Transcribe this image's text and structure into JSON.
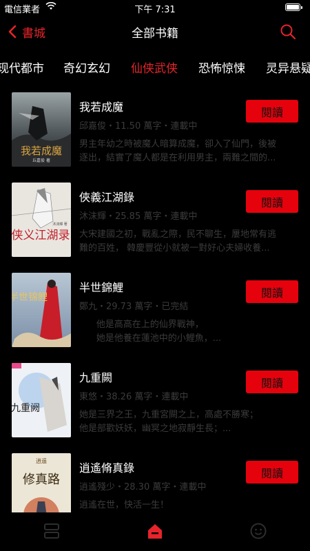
{
  "status": {
    "carrier": "電信業者",
    "time": "下午 7:31",
    "icons": [
      "wifi-icon",
      "battery-icon"
    ]
  },
  "nav": {
    "back_label": "書城",
    "title": "全部书籍",
    "icons": [
      "chevron-left-icon",
      "search-icon"
    ]
  },
  "accent_color": "#e5242b",
  "button_color": "#e5020d",
  "tabs": [
    {
      "label": "现代都市",
      "active": false
    },
    {
      "label": "奇幻玄幻",
      "active": false
    },
    {
      "label": "仙侠武侠",
      "active": true
    },
    {
      "label": "恐怖惊悚",
      "active": false
    },
    {
      "label": "灵异悬疑",
      "active": false
    }
  ],
  "books": [
    {
      "title": "我若成魔",
      "meta": "邱嘉俊・11.50 萬字・連載中",
      "desc": [
        "男主年幼之時被魔人暗算成魔，卻入了仙門，後被",
        "逐出，結實了魔人都是在利用男主，兩難之間的..."
      ],
      "read_label": "閱讀",
      "cover_text": "我若成魔",
      "cover_caption": "丘嘉俊 著"
    },
    {
      "title": "俠義江湖錄",
      "meta": "沐沫輝・25.85 萬字・連載中",
      "desc": [
        "大宋建國之初，戰亂之際，民不聊生，屢地常有逃",
        "難的百姓，   韓慶豐從小就被一對好心夫婦收養..."
      ],
      "read_label": "閱讀",
      "cover_text": "侠义江湖录",
      "cover_caption": "沐沫輝 著"
    },
    {
      "title": "半世錦鯉",
      "meta": "鄭九・29.73 萬字・已完結",
      "desc": [
        "      他是高高在上的仙界戰神，",
        "      她是他養在蓮池中的小鯉魚，..."
      ],
      "read_label": "閱讀",
      "cover_text": "半世锦鲤",
      "cover_caption": ""
    },
    {
      "title": "九重闕",
      "meta": "東悠・38.26 萬字・連載中",
      "desc": [
        "她是三界之王，九重宮闕之上，高處不勝寒；",
        "他是部歡妖妖，幽冥之地寂靜生長；..."
      ],
      "read_label": "閱讀",
      "cover_text": "九重阙",
      "cover_caption": ""
    },
    {
      "title": "逍遙脩真錄",
      "meta": "逍遙殘少・28.30 萬字・連載中",
      "desc": [
        "逍遙在世，快活一生！",
        ""
      ],
      "read_label": "閱讀",
      "cover_text": "修真路",
      "cover_caption": "逍遥"
    }
  ],
  "tabbar": {
    "icons": [
      "bookshelf-icon",
      "bookstore-home-icon",
      "profile-face-icon"
    ],
    "active_index": 1
  }
}
